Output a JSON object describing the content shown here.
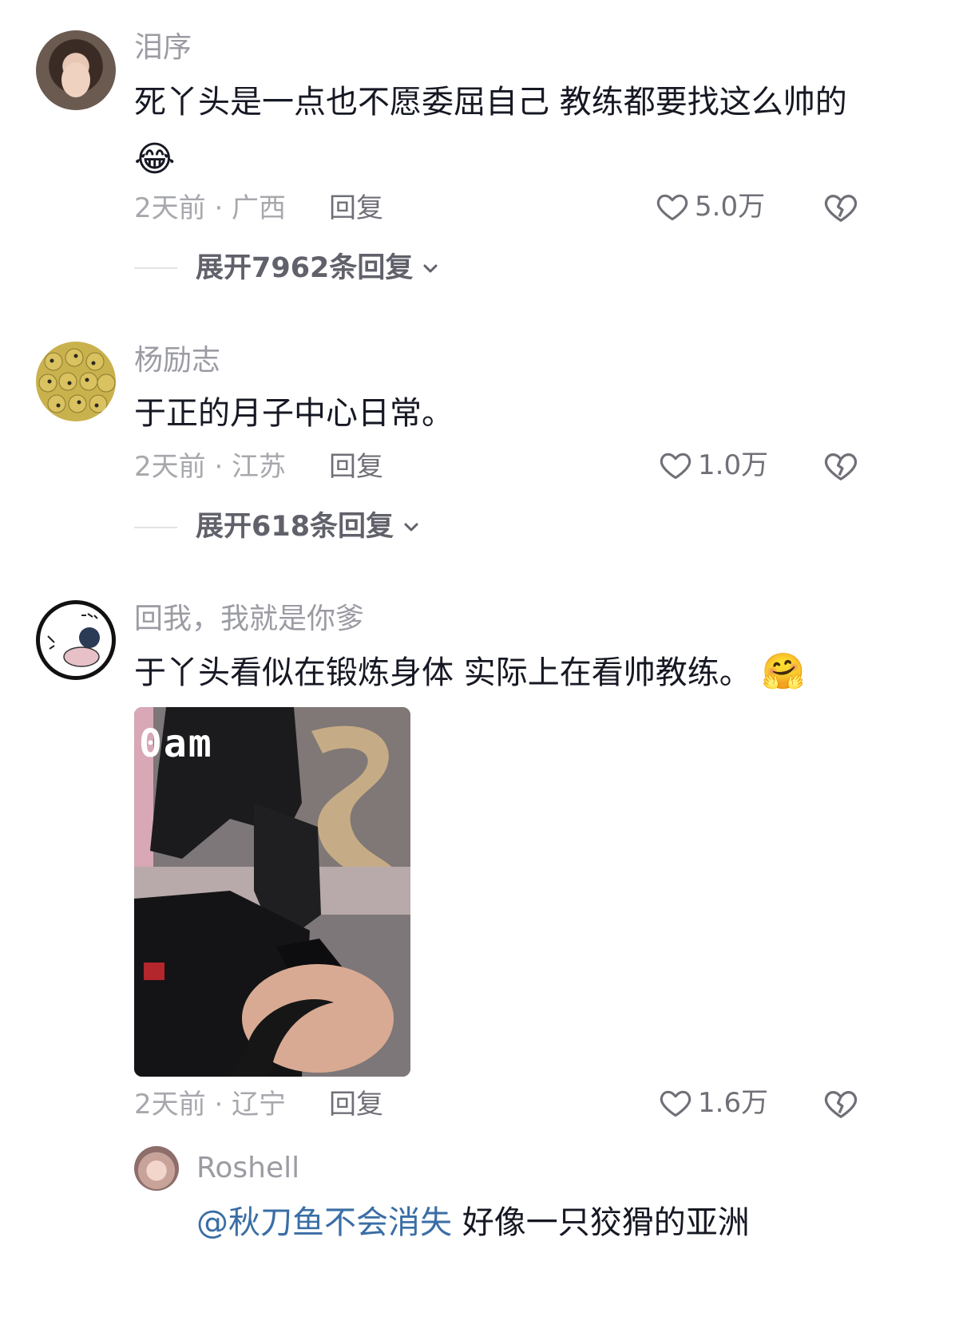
{
  "comments": [
    {
      "username": "泪序",
      "text": "死丫头是一点也不愿委屈自己 教练都要找这么帅的",
      "emoji": "😂",
      "time_location": "2天前 · 广西",
      "reply_label": "回复",
      "likes": "5.0万",
      "expand_label": "展开7962条回复"
    },
    {
      "username": "杨励志",
      "text": "于正的月子中心日常。",
      "time_location": "2天前 · 江苏",
      "reply_label": "回复",
      "likes": "1.0万",
      "expand_label": "展开618条回复"
    },
    {
      "username": "回我，我就是你爹",
      "text": "于丫头看似在锻炼身体 实际上在看帅教练。",
      "emoji": "🤗",
      "image_overlay_text": "0am",
      "time_location": "2天前 · 辽宁",
      "reply_label": "回复",
      "likes": "1.6万"
    }
  ],
  "sub_reply": {
    "username": "Roshell",
    "mention": "@秋刀鱼不会消失",
    "text": " 好像一只狡猾的亚洲"
  },
  "icons": {
    "like": "heart-outline-icon",
    "dislike": "broken-heart-icon",
    "expand": "chevron-down-icon"
  },
  "colors": {
    "primary_text": "#161823",
    "secondary_text": "#9b9ca3",
    "mention": "#3a6ea5"
  }
}
